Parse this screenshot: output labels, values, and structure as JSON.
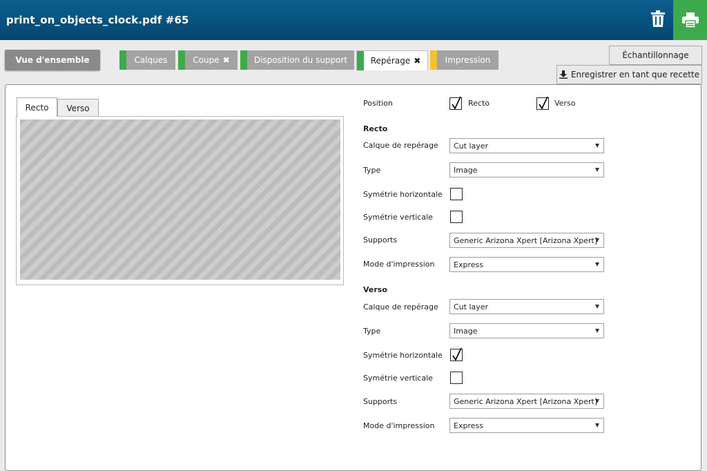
{
  "header": {
    "title": "print_on_objects_clock.pdf #65",
    "delete_icon": "trash-icon",
    "print_icon": "printer-icon"
  },
  "colors": {
    "header": "#04466f",
    "print_button": "#3dab4c",
    "status_ok": "#3dab4c",
    "status_warning": "#f2c230"
  },
  "tabs": {
    "overview": "Vue d'ensemble",
    "layers": "Calques",
    "cut": "Coupe",
    "media_layout": "Disposition du support",
    "registration": "Repérage",
    "print": "Impression"
  },
  "buttons": {
    "sampling": "Échantillonnage",
    "save_recipe": "Enregistrer en tant que recette"
  },
  "preview": {
    "tab_front": "Recto",
    "tab_back": "Verso"
  },
  "form": {
    "position_label": "Position",
    "position_front_label": "Recto",
    "position_front_checked": true,
    "position_back_label": "Verso",
    "position_back_checked": true,
    "front": {
      "heading": "Recto",
      "registration_layer_label": "Calque de repérage",
      "registration_layer_value": "Cut layer",
      "type_label": "Type",
      "type_value": "Image",
      "hflip_label": "Symétrie horizontale",
      "hflip_checked": false,
      "vflip_label": "Symétrie verticale",
      "vflip_checked": false,
      "media_label": "Supports",
      "media_value": "Generic Arizona Xpert [Arizona Xpert]",
      "mode_label": "Mode d'impression",
      "mode_value": "Express"
    },
    "back": {
      "heading": "Verso",
      "registration_layer_label": "Calque de repérage",
      "registration_layer_value": "Cut layer",
      "type_label": "Type",
      "type_value": "Image",
      "hflip_label": "Symétrie horizontale",
      "hflip_checked": true,
      "vflip_label": "Symétrie verticale",
      "vflip_checked": false,
      "media_label": "Supports",
      "media_value": "Generic Arizona Xpert [Arizona Xpert]",
      "mode_label": "Mode d'impression",
      "mode_value": "Express"
    }
  }
}
